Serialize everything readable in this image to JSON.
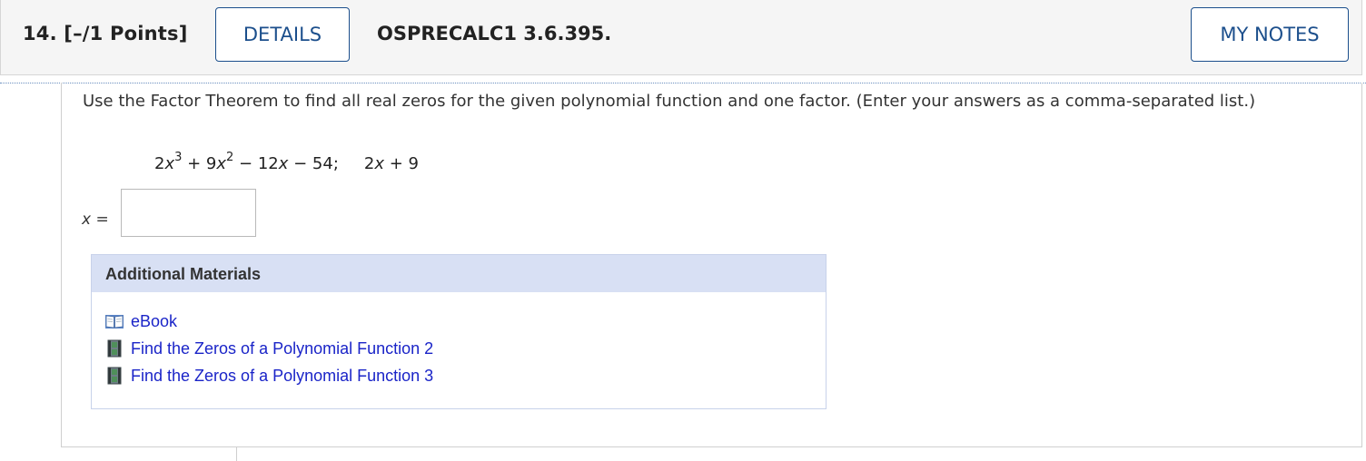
{
  "header": {
    "points": "14.  [–/1 Points]",
    "details_label": "DETAILS",
    "problem_code": "OSPRECALC1 3.6.395.",
    "my_notes_label": "MY NOTES"
  },
  "question": {
    "text": "Use the Factor Theorem to find all real zeros for the given polynomial function and one factor. (Enter your answers as a comma-separated list.)",
    "polynomial": {
      "t1_coef": "2",
      "t1_var": "x",
      "t1_exp": "3",
      "t2": " + 9",
      "t2_var": "x",
      "t2_exp": "2",
      "t3": " − 12",
      "t3_var": "x",
      "t4": " − 54;",
      "factor_coef": "2",
      "factor_var": "x",
      "factor_rest": " + 9"
    },
    "answer_var": "x",
    "answer_eq": " =",
    "answer_value": ""
  },
  "materials": {
    "title": "Additional Materials",
    "items": [
      {
        "label": "eBook",
        "icon": "book-icon"
      },
      {
        "label": "Find the Zeros of a Polynomial Function 2",
        "icon": "film-icon"
      },
      {
        "label": "Find the Zeros of a Polynomial Function 3",
        "icon": "film-icon"
      }
    ]
  },
  "colors": {
    "accent": "#1c4f8c",
    "link": "#1a24c8",
    "materials_header": "#d8e0f4"
  }
}
